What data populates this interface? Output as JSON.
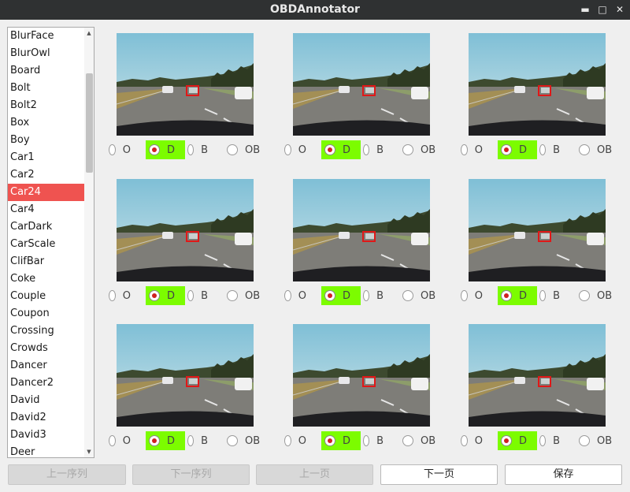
{
  "window": {
    "title": "OBDAnnotator"
  },
  "sequence_list": {
    "items": [
      "BlurFace",
      "BlurOwl",
      "Board",
      "Bolt",
      "Bolt2",
      "Box",
      "Boy",
      "Car1",
      "Car2",
      "Car24",
      "Car4",
      "CarDark",
      "CarScale",
      "ClifBar",
      "Coke",
      "Couple",
      "Coupon",
      "Crossing",
      "Crowds",
      "Dancer",
      "Dancer2",
      "David",
      "David2",
      "David3",
      "Deer"
    ],
    "selected": "Car24"
  },
  "grid": {
    "options": [
      "O",
      "D",
      "B",
      "OB"
    ],
    "frames": [
      {
        "selected": "D"
      },
      {
        "selected": "D"
      },
      {
        "selected": "D"
      },
      {
        "selected": "D"
      },
      {
        "selected": "D"
      },
      {
        "selected": "D"
      },
      {
        "selected": "D"
      },
      {
        "selected": "D"
      },
      {
        "selected": "D"
      }
    ]
  },
  "colors": {
    "selected_option": "#7cfc00",
    "selected_list_item": "#ef5350",
    "bbox": "#e01818"
  },
  "buttons": {
    "prev_sequence": {
      "label": "上一序列",
      "enabled": false
    },
    "next_sequence": {
      "label": "下一序列",
      "enabled": false
    },
    "prev_page": {
      "label": "上一页",
      "enabled": false
    },
    "next_page": {
      "label": "下一页",
      "enabled": true
    },
    "save": {
      "label": "保存",
      "enabled": true
    }
  }
}
